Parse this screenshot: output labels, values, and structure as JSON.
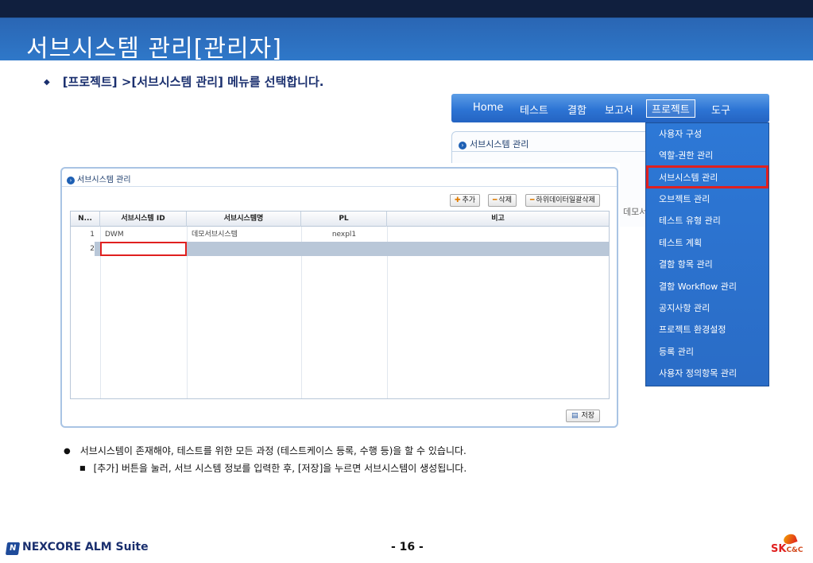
{
  "slide": {
    "title": "서브시스템 관리[관리자]",
    "instruction": "[프로젝트] >[서브시스템  관리] 메뉴를 선택합니다.",
    "instruction_bullet": "◆",
    "notes": [
      "서브시스템이 존재해야,  테스트를 위한 모든 과정 (테스트케이스 등록, 수행 등)을 할 수 있습니다.",
      "[추가] 버튼을 눌러, 서브 시스템 정보를 입력한 후, [저장]을 누르면 서브시스템이 생성됩니다."
    ],
    "note_bullets": [
      "●",
      "■"
    ],
    "page_number": "- 16 -",
    "footer_brand": "NEXCORE ALM Suite",
    "footer_brand_icon": "N",
    "corner_logo": "SK",
    "corner_logo_sub": "C&C"
  },
  "menubar": {
    "items": [
      "Home",
      "테스트",
      "결함",
      "보고서",
      "프로젝트",
      "도구"
    ],
    "active": "프로젝트"
  },
  "dropdown": {
    "items": [
      "사용자 구성",
      "역할-권한 관리",
      "서브시스템 관리",
      "오브젝트 관리",
      "테스트 유형 관리",
      "테스트 계획",
      "결함 항목 관리",
      "결함 Workflow 관리",
      "공지사항 관리",
      "프로젝트 환경설정",
      "등록 관리",
      "사용자 정의항목 관리"
    ],
    "selected": "서브시스템 관리"
  },
  "background_panel": {
    "title": "서브시스템 관리",
    "partial_text": "데모서"
  },
  "panel": {
    "title": "서브시스템 관리",
    "buttons": {
      "add": "추가",
      "delete": "삭제",
      "delete_sub": "하위데이터일괄삭제",
      "save": "저장"
    },
    "columns": [
      "N...",
      "서브시스템 ID",
      "서브시스템명",
      "PL",
      "비고"
    ],
    "rows": [
      {
        "no": "1",
        "id": "DWM",
        "name": "데모서브시스템",
        "pl": "nexpl1",
        "note": ""
      },
      {
        "no": "2",
        "id": "",
        "name": "",
        "pl": "",
        "note": ""
      }
    ]
  },
  "colors": {
    "title_bar": "#2f78c9",
    "menubar": "#2d74d4",
    "highlight": "#e0201f",
    "brand": "#1a2f6e"
  }
}
